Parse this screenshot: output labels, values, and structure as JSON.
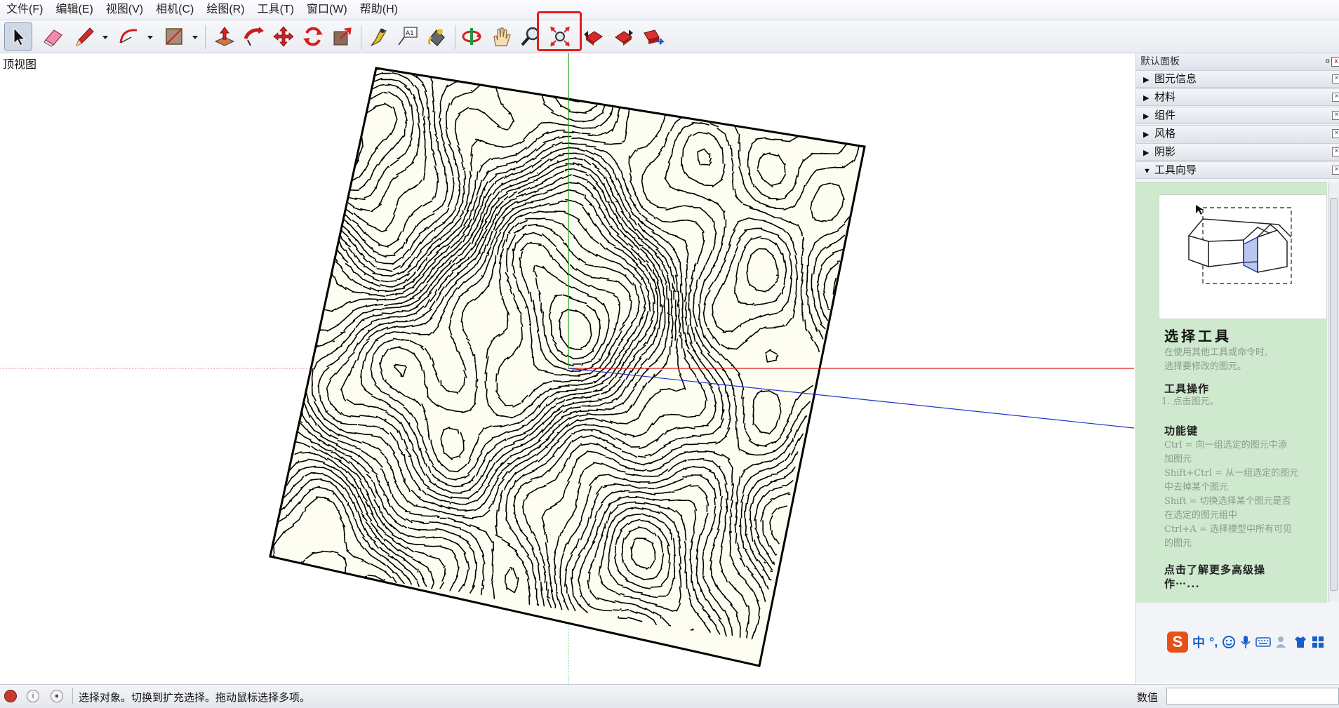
{
  "menu": [
    {
      "label": "文件(F)"
    },
    {
      "label": "编辑(E)"
    },
    {
      "label": "视图(V)"
    },
    {
      "label": "相机(C)"
    },
    {
      "label": "绘图(R)"
    },
    {
      "label": "工具(T)"
    },
    {
      "label": "窗口(W)"
    },
    {
      "label": "帮助(H)"
    }
  ],
  "toolbar": {
    "tools": [
      "select",
      "eraser",
      "pencil",
      "arc",
      "rectangle",
      "push-pull",
      "follow-me",
      "move",
      "rotate",
      "scale",
      "tape-measure",
      "text",
      "paint-bucket",
      "orbit",
      "pan",
      "zoom",
      "zoom-extents",
      "previous-view",
      "next-view",
      "walk"
    ],
    "active_tool": "select",
    "highlighted_tool": "zoom-extents",
    "highlight_color": "#e21c1c"
  },
  "viewport": {
    "view_label": "顶视图",
    "terrain_fill": "#fefdf1",
    "axis_colors": {
      "red": "#d61e1e",
      "green": "#1fa31f",
      "blue": "#2233cc"
    }
  },
  "panel": {
    "title": "默认面板",
    "pin_glyph": "¤",
    "trays": [
      {
        "label": "图元信息",
        "expanded": false
      },
      {
        "label": "材料",
        "expanded": false
      },
      {
        "label": "组件",
        "expanded": false
      },
      {
        "label": "风格",
        "expanded": false
      },
      {
        "label": "阴影",
        "expanded": false
      },
      {
        "label": "工具向导",
        "expanded": true
      }
    ],
    "instructor": {
      "title": "选择工具",
      "desc_line1": "在使用其他工具或命令时,",
      "desc_line2": "选择要修改的图元。",
      "ops_head": "工具操作",
      "ops_item": "1.   点击图元。",
      "keys_head": "功能键",
      "keys": [
        "Ctrl = 向一组选定的图元中添",
        "加图元",
        "Shift+Ctrl = 从一组选定的图元",
        "中去掉某个图元",
        "Shift = 切换选择某个图元是否",
        "在选定的图元组中",
        "Ctrl+A = 选择模型中所有可见",
        "的图元"
      ],
      "more_line1": "点击了解更多高级操",
      "more_line2": "作⋯..."
    },
    "bg_color": "#cfe9cf"
  },
  "ime": {
    "logo": "S",
    "mode": "中",
    "punct": "°,"
  },
  "status": {
    "text": "选择对象。切换到扩充选择。拖动鼠标选择多项。",
    "value_label": "数值",
    "value": ""
  }
}
